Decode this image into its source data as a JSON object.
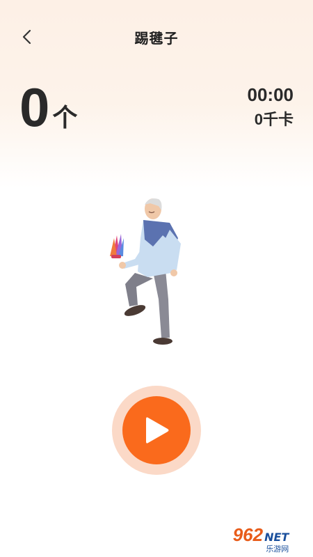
{
  "header": {
    "title": "踢毽子",
    "back_icon": "chevron-left-icon"
  },
  "stats": {
    "count": "0",
    "count_unit": "个",
    "time": "00:00",
    "calories": "0千卡"
  },
  "illustration": {
    "name": "elderly-man-kicking-shuttlecock"
  },
  "controls": {
    "play_icon": "play-icon",
    "accent_color": "#fa6a1c",
    "ring_color": "#fbd9c7"
  },
  "watermark": {
    "brand": "962",
    "suffix": "NET",
    "sub": "乐游网"
  }
}
